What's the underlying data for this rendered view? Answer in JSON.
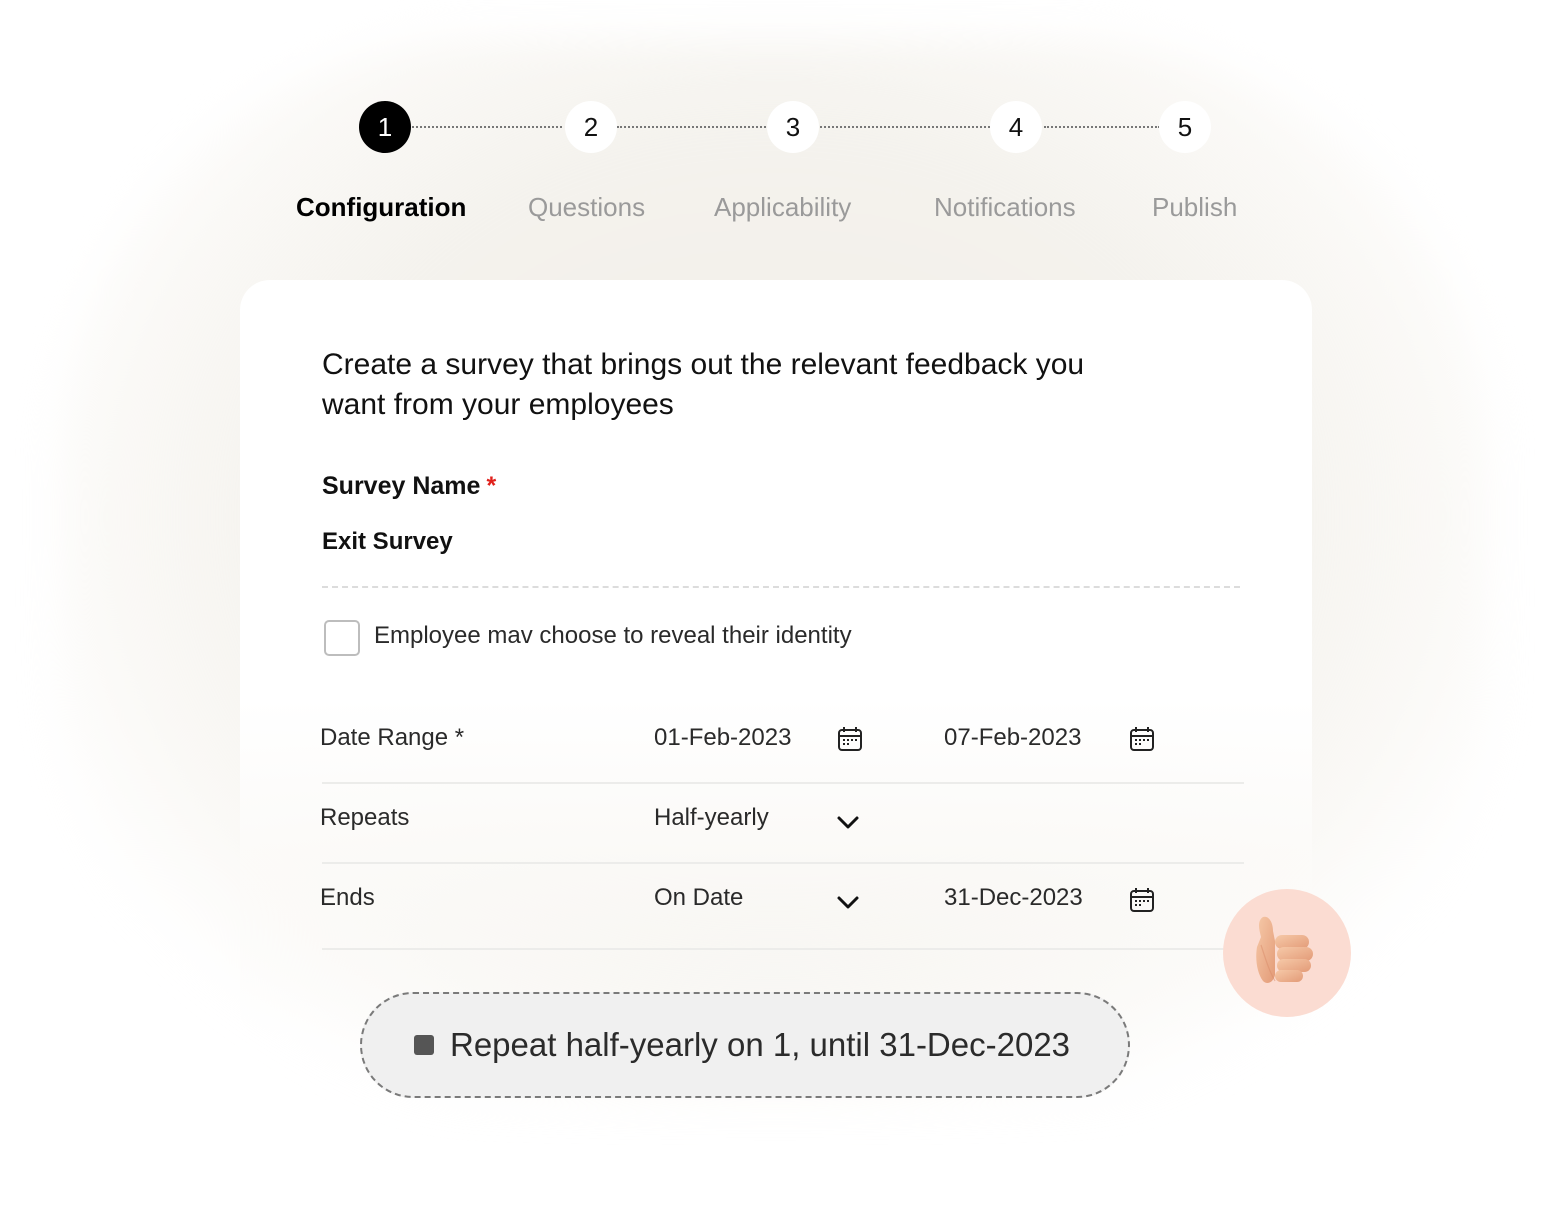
{
  "stepper": {
    "steps": [
      {
        "number": "1",
        "label": "Configuration",
        "active": true
      },
      {
        "number": "2",
        "label": "Questions",
        "active": false
      },
      {
        "number": "3",
        "label": "Applicability",
        "active": false
      },
      {
        "number": "4",
        "label": "Notifications",
        "active": false
      },
      {
        "number": "5",
        "label": "Publish",
        "active": false
      }
    ]
  },
  "form": {
    "headline": "Create a survey that brings out the relevant feedback you want from your employees",
    "survey_name": {
      "label": "Survey Name",
      "required_marker": "*",
      "value": "Exit Survey"
    },
    "identity_checkbox": {
      "label": "Employee mav choose to reveal their identity",
      "checked": false
    },
    "date_range": {
      "label": "Date Range *",
      "start": "01-Feb-2023",
      "end": "07-Feb-2023",
      "icon": "calendar-icon"
    },
    "repeats": {
      "label": "Repeats",
      "value": "Half-yearly",
      "icon": "chevron-down-icon"
    },
    "ends": {
      "label": "Ends",
      "value": "On Date",
      "date": "31-Dec-2023",
      "icon": "chevron-down-icon"
    }
  },
  "summary": {
    "text": "Repeat half-yearly on 1, until 31-Dec-2023"
  },
  "badge": {
    "icon": "thumbs-up-icon"
  },
  "colors": {
    "active_step": "#000000",
    "inactive_step_label": "#9a9a9a",
    "required": "#e0211c",
    "badge_bg": "#fbdcd2"
  }
}
